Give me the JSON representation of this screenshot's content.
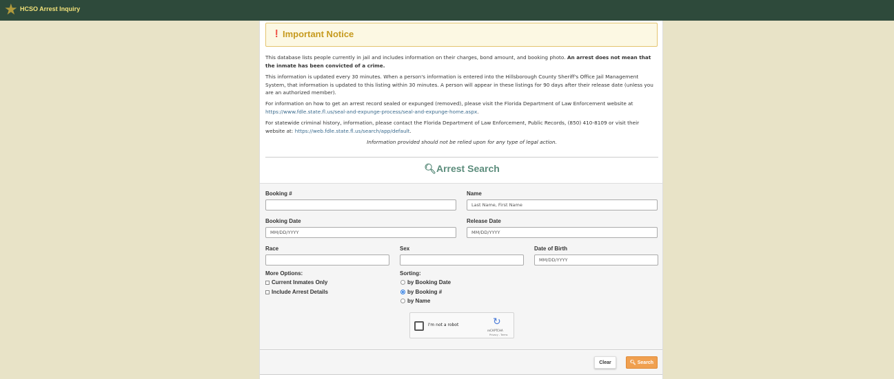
{
  "header": {
    "title": "HCSO Arrest Inquiry"
  },
  "notice": {
    "title": "Important Notice",
    "p1": "This database lists people currently in jail and includes information on their charges, bond amount, and booking photo.",
    "p1_bold": "An arrest does not mean that the inmate has been convicted of a crime.",
    "p2": "This information is updated every 30 minutes. When a person's information is entered into the Hillsborough County Sheriff's Office Jail Management System, that information is updated to this listing within 30 minutes. A person will appear in these listings for 90 days after their release date (unless you are an authorized member).",
    "p3": "For information on how to get an arrest record sealed or expunged (removed), please visit the Florida Department of Law Enforcement website at",
    "p3_link": "https://www.fdle.state.fl.us/seal-and-expunge-process/seal-and-expunge-home.aspx",
    "p4": "For statewide criminal history, information, please contact the Florida Department of Law Enforcement, Public Records, (850) 410-8109 or visit their website at:",
    "p4_link": "https://web.fdle.state.fl.us/search/app/default",
    "disclaimer": "Information provided should not be relied upon for any type of legal action."
  },
  "search": {
    "title": "Arrest Search",
    "booking_label": "Booking #",
    "booking_value": "",
    "name_label": "Name",
    "name_placeholder": "Last Name, First Name",
    "booking_date_label": "Booking Date",
    "booking_date_placeholder": "MM/DD/YYYY",
    "release_date_label": "Release Date",
    "release_date_placeholder": "MM/DD/YYYY",
    "race_label": "Race",
    "sex_label": "Sex",
    "dob_label": "Date of Birth",
    "dob_placeholder": "MM/DD/YYYY",
    "more_options_label": "More Options:",
    "options": [
      "Current Inmates Only",
      "Include Arrest Details"
    ],
    "sorting_label": "Sorting:",
    "sorting": [
      "by Booking Date",
      "by Booking #",
      "by Name"
    ],
    "sorting_selected": "by Booking #",
    "captcha_label": "I'm not a robot",
    "captcha_brand": "reCAPTCHA",
    "captcha_links": "Privacy - Terms",
    "clear_label": "Clear",
    "search_label": "Search"
  }
}
